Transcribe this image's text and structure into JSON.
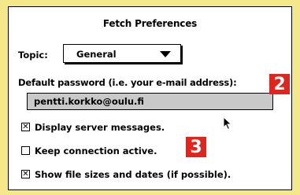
{
  "window": {
    "title": "Fetch Preferences"
  },
  "topic": {
    "label": "Topic:",
    "value": "General",
    "arrow_icon": "triangle-down-icon"
  },
  "password": {
    "label": "Default password (i.e. your e-mail address):",
    "value": "pentti.korkko@oulu.fi"
  },
  "options": [
    {
      "label": "Display server messages.",
      "checked": true,
      "mark": "☒"
    },
    {
      "label": "Keep connection active.",
      "checked": false,
      "mark": ""
    },
    {
      "label": "Show file sizes and dates (if possible).",
      "checked": true,
      "mark": "☒"
    }
  ],
  "markers": {
    "m2": "2",
    "m3": "3",
    "color": "#e0241e"
  },
  "colors": {
    "background": "#f4e88a",
    "field_bg": "#c9c9c9"
  }
}
